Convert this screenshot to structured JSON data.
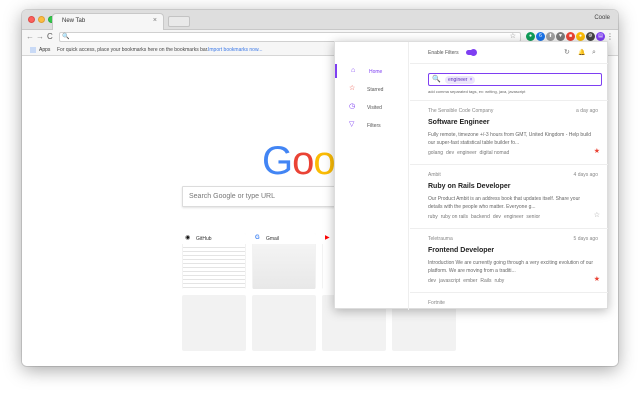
{
  "browser": {
    "tab_title": "New Tab",
    "tab_close": "×",
    "profile": "Coole",
    "back": "←",
    "forward": "→",
    "reload": "C",
    "omnibox_icon": "🔍",
    "omnibox_star": "☆",
    "extensions": [
      {
        "name": "green-extension-icon",
        "color": "#0f9d58",
        "glyph": "●"
      },
      {
        "name": "blue-extension-icon",
        "color": "#1a73e8",
        "glyph": "6"
      },
      {
        "name": "gray-extension-icon",
        "color": "#9e9e9e",
        "glyph": "⬆"
      },
      {
        "name": "funnel-extension-icon",
        "color": "#7a7a7a",
        "glyph": "▼"
      },
      {
        "name": "red-extension-icon",
        "color": "#ea4335",
        "glyph": "■"
      },
      {
        "name": "multicolor-extension-icon",
        "color": "#fbbc05",
        "glyph": "●"
      },
      {
        "name": "dark-extension-icon",
        "color": "#444444",
        "glyph": "⚙"
      },
      {
        "name": "purple-extension-icon",
        "color": "#7e3ff2",
        "glyph": "▤"
      }
    ],
    "menu_icon": "⋮"
  },
  "bookmarks": {
    "apps_label": "Apps",
    "hint": "For quick access, place your bookmarks here on the bookmarks bar.",
    "import_link": "Import bookmarks now..."
  },
  "newtab": {
    "logo_letters": [
      {
        "char": "G",
        "color": "#4285f4"
      },
      {
        "char": "o",
        "color": "#ea4335"
      },
      {
        "char": "o",
        "color": "#fbbc05"
      },
      {
        "char": "g",
        "color": "#4285f4"
      },
      {
        "char": "l",
        "color": "#34a853"
      },
      {
        "char": "e",
        "color": "#ea4335"
      }
    ],
    "search_placeholder": "Search Google or type URL",
    "tiles": [
      {
        "label": "GitHub",
        "icon": "◉",
        "icon_color": "#111111"
      },
      {
        "label": "Gmail",
        "icon": "G",
        "icon_color": "#4285f4"
      },
      {
        "label": "",
        "icon": "▶",
        "icon_color": "#ff0000"
      }
    ]
  },
  "extension_panel": {
    "accent": "#7e3ff2",
    "nav": [
      {
        "label": "Home",
        "icon": "⌂",
        "active": true
      },
      {
        "label": "Starred",
        "icon": "☆",
        "active": false
      },
      {
        "label": "Visited",
        "icon": "◷",
        "active": false
      },
      {
        "label": "Filters",
        "icon": "▽",
        "active": false
      }
    ],
    "header": {
      "enable_filters_label": "Enable Filters",
      "refresh_icon": "↻",
      "bell_icon": "🔔",
      "search_icon": "⌕"
    },
    "search": {
      "icon": "🔍",
      "chip": "engineer",
      "chip_close": "×",
      "hint": "add comma separated tags, ex: writing, java, javascript"
    },
    "jobs": [
      {
        "company": "The Sensible Code Company",
        "age": "a day ago",
        "title": "Software Engineer",
        "description": "Fully remote, timezone +/-3 hours from GMT, United Kingdom - Help build our super-fast statistical table builder fo...",
        "tags": [
          "golang",
          "dev",
          "engineer",
          "digital nomad"
        ],
        "starred": true
      },
      {
        "company": "Ambit",
        "age": "4 days ago",
        "title": "Ruby on Rails Developer",
        "description": "Our Product Ambit is an address book that updates itself. Share your details with the people who matter. Everyone g...",
        "tags": [
          "ruby",
          "ruby on rails",
          "backend",
          "dev",
          "engineer",
          "senior"
        ],
        "starred": false
      },
      {
        "company": "Teletrauma",
        "age": "5 days ago",
        "title": "Frontend Developer",
        "description": "Introduction We are currently going through a very exciting evolution of our platform. We are moving from a traditi...",
        "tags": [
          "dev",
          "javascript",
          "ember",
          "Rails",
          "ruby"
        ],
        "starred": true
      },
      {
        "company": "Fortnite",
        "age": "",
        "title": "",
        "description": "",
        "tags": [],
        "starred": false
      }
    ]
  }
}
